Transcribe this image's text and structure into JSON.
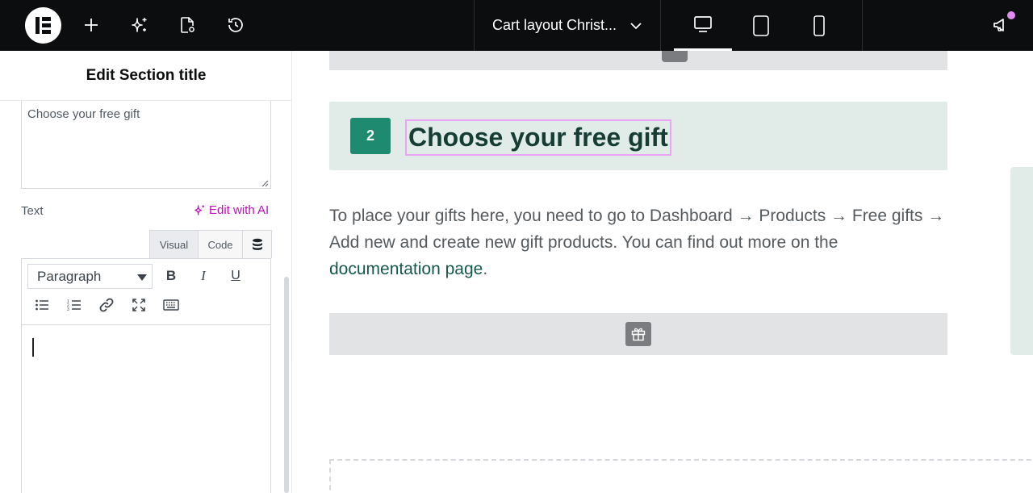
{
  "topbar": {
    "logo_icon": "elementor-logo-icon",
    "add_icon": "plus-icon",
    "ai_icon": "sparkle-icon",
    "page_settings_icon": "page-settings-icon",
    "history_icon": "history-icon",
    "document_title": "Cart layout Christ...",
    "devices": [
      "desktop",
      "tablet",
      "mobile"
    ],
    "active_device": "desktop",
    "notifications_icon": "megaphone-icon"
  },
  "panel": {
    "header_title": "Edit Section title",
    "title_value": "Choose your free gift",
    "text_label": "Text",
    "edit_ai_label": "Edit with AI",
    "tabs": {
      "visual": "Visual",
      "code": "Code"
    },
    "editor": {
      "format_value": "Paragraph",
      "buttons": {
        "bold": "B",
        "italic": "I",
        "underline": "U"
      }
    }
  },
  "canvas": {
    "step_number": "2",
    "section_heading": "Choose your free gift",
    "description_prefix": "To place your gifts here, you need to go to Dashboard → Products → Free gifts → Add new and create new gift products. You can find out more on the ",
    "description_link": "documentation page",
    "description_suffix": "."
  },
  "colors": {
    "topbar_bg": "#0c0d0e",
    "ai_accent": "#c00bb9",
    "badge_green": "#1e8a70",
    "heading_dark_green": "#153d33",
    "mint_bg": "#e1ece9",
    "selection_outline": "#e9a5f3"
  }
}
